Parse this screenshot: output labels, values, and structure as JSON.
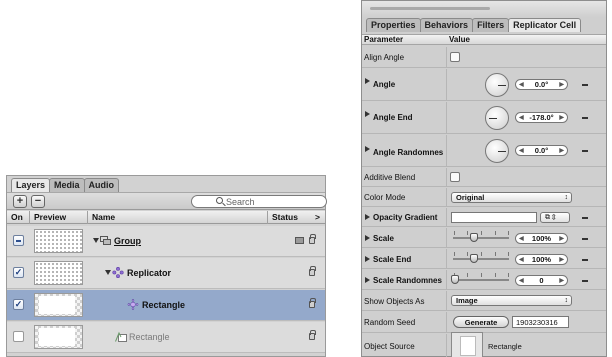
{
  "layers_panel": {
    "tabs": [
      "Layers",
      "Media",
      "Audio"
    ],
    "active_tab": "Layers",
    "add_label": "+",
    "remove_label": "−",
    "search_placeholder": "Search",
    "headers": {
      "on": "On",
      "preview": "Preview",
      "name": "Name",
      "status": "Status"
    },
    "rows": [
      {
        "name": "Group",
        "checked": "mixed",
        "selected": false
      },
      {
        "name": "Replicator",
        "checked": "on",
        "selected": false
      },
      {
        "name": "Rectangle",
        "checked": "on",
        "selected": true
      },
      {
        "name": "Rectangle",
        "checked": "off",
        "selected": false
      }
    ]
  },
  "inspector": {
    "tabs": [
      "Properties",
      "Behaviors",
      "Filters",
      "Replicator Cell"
    ],
    "active_tab": "Replicator Cell",
    "headers": {
      "parameter": "Parameter",
      "value": "Value"
    },
    "params": {
      "align_angle": "Align Angle",
      "angle": "Angle",
      "angle_value": "0.0°",
      "angle_end": "Angle End",
      "angle_end_value": "-178.0°",
      "angle_random": "Angle Randomnes",
      "angle_random_value": "0.0°",
      "additive_blend": "Additive Blend",
      "color_mode": "Color Mode",
      "color_mode_value": "Original",
      "opacity_gradient": "Opacity Gradient",
      "scale": "Scale",
      "scale_value": "100%",
      "scale_end": "Scale End",
      "scale_end_value": "100%",
      "scale_random": "Scale Randomnes",
      "scale_random_value": "0",
      "show_objects_as": "Show Objects As",
      "show_objects_as_value": "Image",
      "random_seed": "Random Seed",
      "generate": "Generate",
      "seed_value": "1903230316",
      "object_source": "Object Source",
      "object_source_value": "Rectangle"
    }
  }
}
